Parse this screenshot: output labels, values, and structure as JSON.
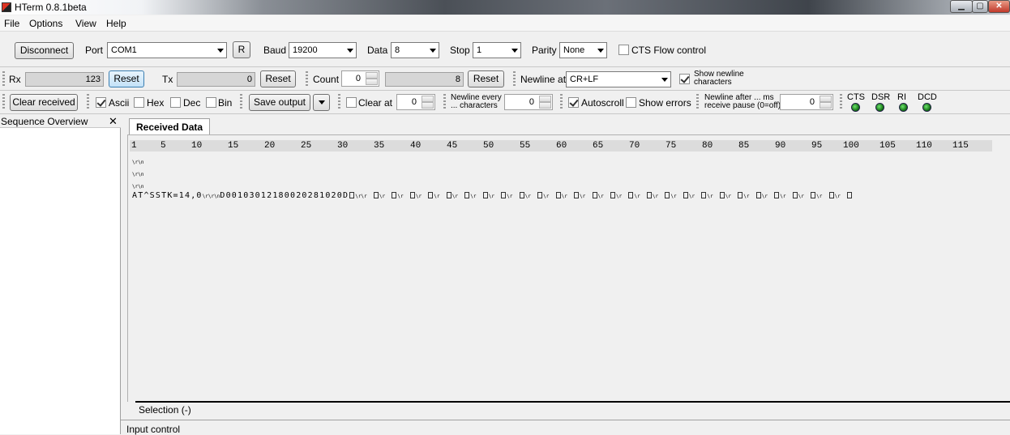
{
  "window": {
    "title": "HTerm 0.8.1beta",
    "minimize": "▁",
    "maximize": "▢",
    "close": "✕"
  },
  "menu": {
    "items": [
      "File",
      "Options",
      "View",
      "Help"
    ]
  },
  "connection": {
    "disconnect_label": "Disconnect",
    "port_label": "Port",
    "port_value": "COM1",
    "r_label": "R",
    "baud_label": "Baud",
    "baud_value": "19200",
    "data_label": "Data",
    "data_value": "8",
    "stop_label": "Stop",
    "stop_value": "1",
    "parity_label": "Parity",
    "parity_value": "None",
    "cts_flow_label": "CTS Flow control",
    "cts_flow_checked": false
  },
  "counters": {
    "rx_label": "Rx",
    "rx_value": "123",
    "rx_reset": "Reset",
    "tx_label": "Tx",
    "tx_value": "0",
    "tx_reset": "Reset",
    "count_label": "Count",
    "count_value": "0",
    "count_field": "8",
    "count_reset": "Reset",
    "newline_at_label": "Newline at",
    "newline_at_value": "CR+LF",
    "show_newline_label_1": "Show newline",
    "show_newline_label_2": "characters",
    "show_newline_checked": true
  },
  "display": {
    "clear_received": "Clear received",
    "ascii": "Ascii",
    "hex": "Hex",
    "dec": "Dec",
    "bin": "Bin",
    "save_output": "Save output",
    "clear_at_label": "Clear at",
    "clear_at_value": "0",
    "newline_every_1": "Newline every",
    "newline_every_2": "... characters",
    "newline_every_value": "0",
    "autoscroll": "Autoscroll",
    "show_errors": "Show errors",
    "newline_after_1": "Newline after ... ms",
    "newline_after_2": "receive pause (0=off)",
    "newline_after_value": "0",
    "signals": [
      "CTS",
      "DSR",
      "RI",
      "DCD"
    ]
  },
  "sequence": {
    "title": "Sequence Overview",
    "close": "✕"
  },
  "received": {
    "tab_label": "Received Data",
    "ruler": [
      "1",
      "5",
      "10",
      "15",
      "20",
      "25",
      "30",
      "35",
      "40",
      "45",
      "50",
      "55",
      "60",
      "65",
      "70",
      "75",
      "80",
      "85",
      "90",
      "95",
      "100",
      "105",
      "110",
      "115"
    ],
    "line_prefix": "AT^SSTK=14,0",
    "line_data": "D00103012180020281020D"
  },
  "selection_label": "Selection (-)",
  "input_control_label": "Input control"
}
